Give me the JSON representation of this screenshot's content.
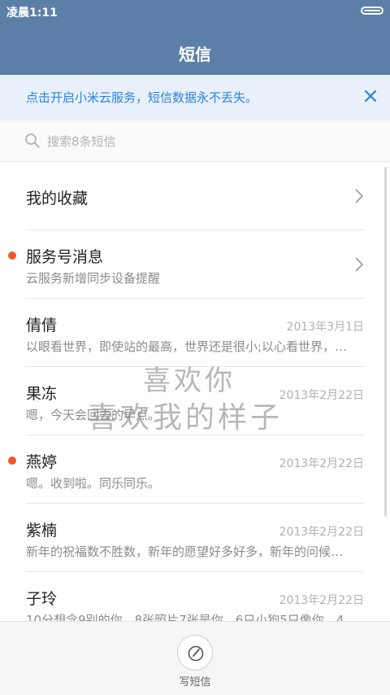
{
  "status_bar": {
    "time": "凌晨1:11"
  },
  "header": {
    "title": "短信"
  },
  "banner": {
    "text": "点击开启小米云服务，短信数据永不丢失。"
  },
  "search": {
    "placeholder": "搜索8条短信"
  },
  "favorites": {
    "label": "我的收藏"
  },
  "service": {
    "title": "服务号消息",
    "subtitle": "云服务新增同步设备提醒",
    "unread": true
  },
  "conversations": [
    {
      "name": "倩倩",
      "date": "2013年3月1日",
      "preview": "以眼看世界，即使站的最高，世界还是很小;以心看世界，…",
      "unread": false
    },
    {
      "name": "果冻",
      "date": "2013年2月22日",
      "preview": "嗯，今天会回去的早点。",
      "unread": false
    },
    {
      "name": "燕婷",
      "date": "2013年2月22日",
      "preview": "嗯。收到啦。同乐同乐。",
      "unread": true
    },
    {
      "name": "紫楠",
      "date": "2013年2月22日",
      "preview": "新年的祝福数不胜数，新年的愿望好多好多，新年的问候…",
      "unread": false
    },
    {
      "name": "子玲",
      "date": "2013年2月22日",
      "preview": "10分想念9别的你，8张照片7张是你，6只小狗5只像你，4…",
      "unread": false
    }
  ],
  "watermark": {
    "line1": "喜欢你",
    "line2": "喜欢我的样子"
  },
  "compose": {
    "label": "写短信"
  },
  "colors": {
    "header": "#5b7fa6",
    "banner_bg": "#e8f1fb",
    "banner_text": "#2b82de",
    "unread_dot": "#f05a24"
  }
}
